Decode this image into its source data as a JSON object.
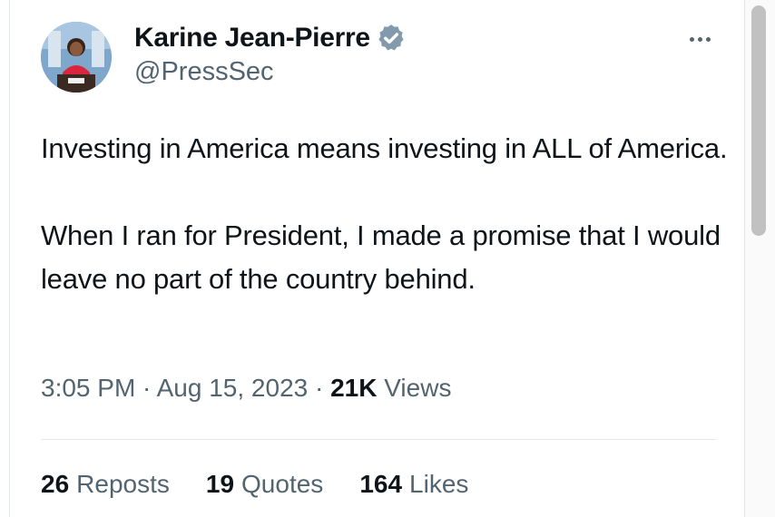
{
  "author": {
    "display_name": "Karine Jean-Pierre",
    "handle": "@PressSec",
    "verified_icon": "verified-badge-icon",
    "badge_color": "#829aab"
  },
  "menu": {
    "icon": "more-options-icon"
  },
  "tweet": {
    "paragraphs": [
      "Investing in America means investing in ALL of America.",
      "When I ran for President, I made a promise that I would leave no part of the country behind."
    ]
  },
  "meta": {
    "time": "3:05 PM",
    "separator1": " · ",
    "date": "Aug 15, 2023",
    "separator2": " · ",
    "views_count": "21K",
    "views_label": "Views"
  },
  "stats": {
    "reposts_count": "26",
    "reposts_label": "Reposts",
    "quotes_count": "19",
    "quotes_label": "Quotes",
    "likes_count": "164",
    "likes_label": "Likes"
  },
  "colors": {
    "text_primary": "#0f1419",
    "text_secondary": "#536471"
  }
}
